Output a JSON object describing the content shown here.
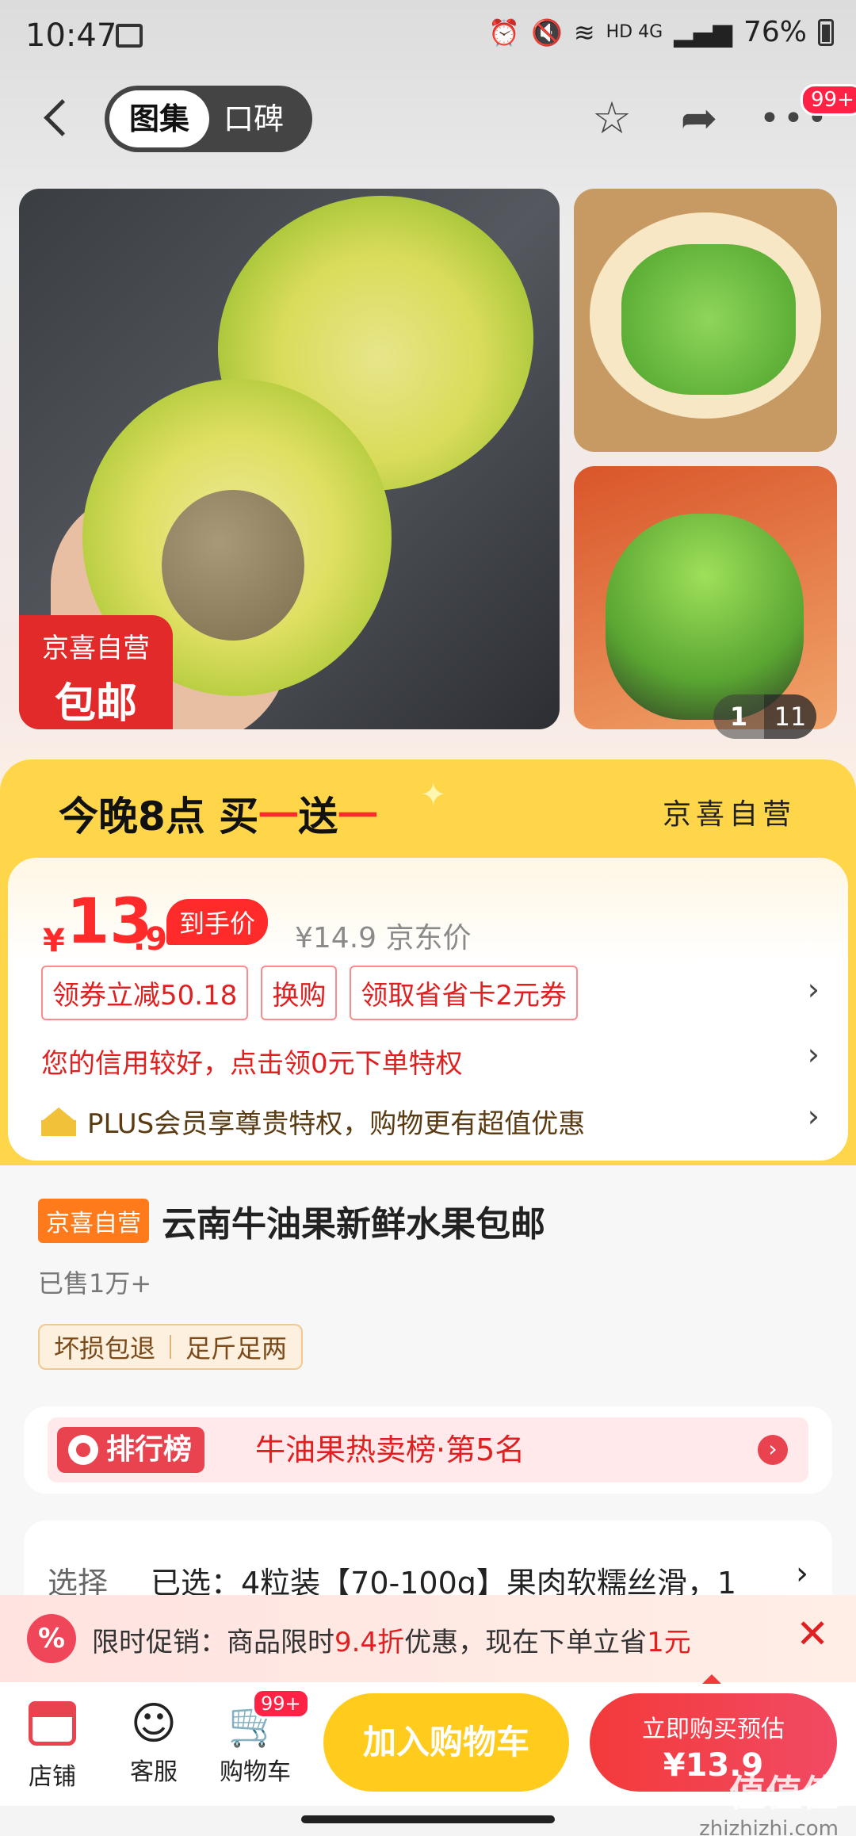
{
  "status_bar": {
    "time": "10:47",
    "network": "HD 4G",
    "battery": "76%"
  },
  "nav": {
    "tab_active": "图集",
    "tab_inactive": "口碑",
    "badge": "99+"
  },
  "gallery": {
    "tag_line1": "京喜自营",
    "tag_line2": "包邮",
    "pager_current": "1",
    "pager_total": "11"
  },
  "promo": {
    "headline_a": "今晚8点 买",
    "headline_b": "一",
    "headline_c": "送",
    "headline_d": "一",
    "self_operated": "京喜自营"
  },
  "price": {
    "currency": "¥",
    "integer": "13",
    "decimal": ".9",
    "tag": "到手价",
    "jd_price": "¥14.9 京东价",
    "chips": [
      "领券立减50.18",
      "换购",
      "领取省省卡2元券"
    ],
    "credit": "您的信用较好，点击领0元下单特权",
    "plus": "PLUS会员享尊贵特权，购物更有超值优惠"
  },
  "product": {
    "badge": "京喜自营",
    "title": "云南牛油果新鲜水果包邮",
    "sold": "已售1万+",
    "guarantees": [
      "坏损包退",
      "足斤足两"
    ],
    "rank_label": "排行榜",
    "rank_text": "牛油果热卖榜·第5名",
    "select_label": "选择",
    "select_value": "已选：4粒装【70-100g】果肉软糯丝滑，1"
  },
  "flash": {
    "icon": "%",
    "pre": "限时促销：商品限时",
    "discount": "9.4折",
    "mid": "优惠，现在下单立省",
    "save": "1元"
  },
  "bottom": {
    "store": "店铺",
    "service": "客服",
    "cart": "购物车",
    "cart_badge": "99+",
    "add_cart": "加入购物车",
    "buy_line1": "立即购买预估",
    "buy_line2": "¥13.9"
  },
  "watermark": {
    "text": "值值值",
    "site": "zhizhizhi.com"
  }
}
